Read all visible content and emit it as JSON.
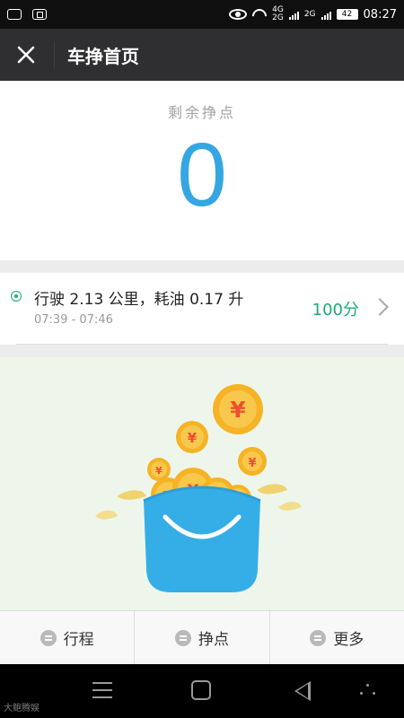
{
  "status_bar": {
    "network_top": "4G",
    "network_bottom": "2G",
    "network2": "2G",
    "battery": "42",
    "time": "08:27"
  },
  "header": {
    "title": "车挣首页",
    "close_icon": "close-icon"
  },
  "points": {
    "label": "剩余挣点",
    "value": "0",
    "color": "#36a6e2"
  },
  "trip": {
    "summary": "行驶 2.13 公里，耗油 0.17 升",
    "time_range": "07:39 - 07:46",
    "score": "100分",
    "accent_color": "#1aac75"
  },
  "promo": {
    "coin_symbol": "¥",
    "basket_color": "#35aee7"
  },
  "tabs": [
    {
      "label": "行程"
    },
    {
      "label": "挣点"
    },
    {
      "label": "更多"
    }
  ],
  "watermark": "大鲍腾娱"
}
